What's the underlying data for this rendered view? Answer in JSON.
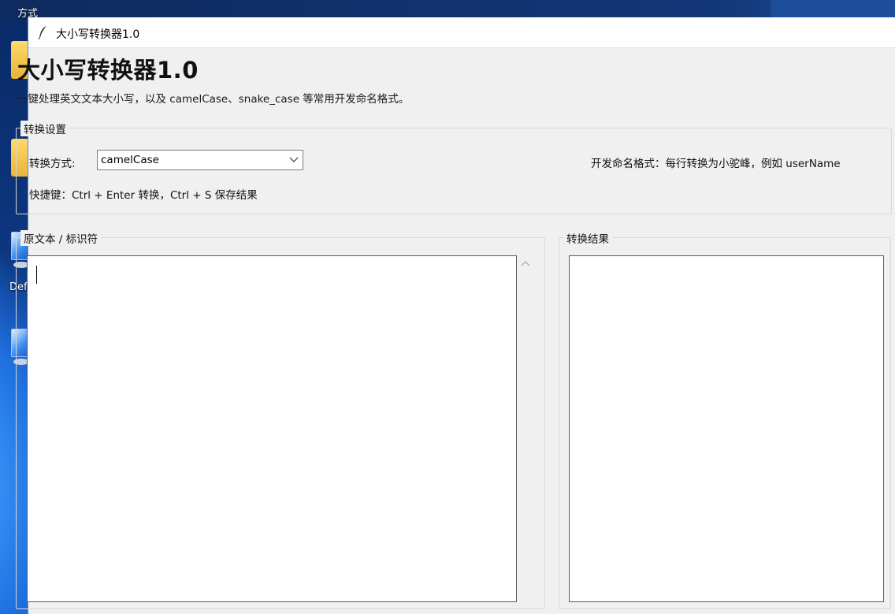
{
  "desktop": {
    "top_label": "方式",
    "icon_label": "Def"
  },
  "window": {
    "title": "大小写转换器1.0",
    "icon": "feather-icon"
  },
  "app": {
    "heading": "大小写转换器1.0",
    "description": "一键处理英文文本大小写，以及 camelCase、snake_case 等常用开发命名格式。"
  },
  "settings": {
    "group_title": "转换设置",
    "mode_label": "转换方式:",
    "mode_value": "camelCase",
    "mode_hint": "开发命名格式：每行转换为小驼峰，例如 userName",
    "shortcut_hint": "快捷键：Ctrl + Enter 转换，Ctrl + S 保存结果"
  },
  "source": {
    "group_title": "原文本 / 标识符",
    "text": ""
  },
  "result": {
    "group_title": "转换结果",
    "text": ""
  }
}
